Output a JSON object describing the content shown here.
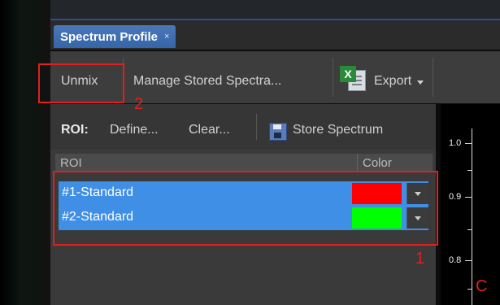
{
  "tab": {
    "title": "Spectrum Profile",
    "close": "×"
  },
  "toolbar": {
    "unmix": "Unmix",
    "manage": "Manage Stored Spectra...",
    "export_icon": "excel-icon",
    "export": "Export"
  },
  "subtoolbar": {
    "roi_label": "ROI:",
    "define": "Define...",
    "clear": "Clear...",
    "save_icon": "save-icon",
    "store": "Store Spectrum"
  },
  "table": {
    "headers": [
      "ROI",
      "Color"
    ],
    "rows": [
      {
        "label": "#1-Standard",
        "color": "#ff0000"
      },
      {
        "label": "#2-Standard",
        "color": "#00ff00"
      }
    ],
    "selection_color": "#3f8fe6"
  },
  "plot": {
    "ticks": [
      "1.0",
      "0.9",
      "0.8"
    ]
  },
  "annotations": {
    "one": "1",
    "two": "2",
    "c": "C",
    "color": "#e02020"
  }
}
